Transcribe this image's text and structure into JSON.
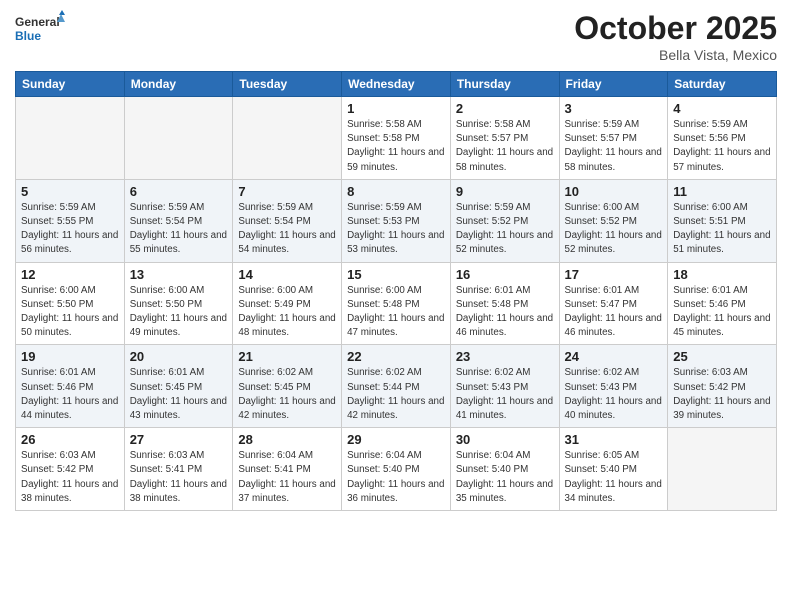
{
  "header": {
    "logo_general": "General",
    "logo_blue": "Blue",
    "month_title": "October 2025",
    "location": "Bella Vista, Mexico"
  },
  "days_of_week": [
    "Sunday",
    "Monday",
    "Tuesday",
    "Wednesday",
    "Thursday",
    "Friday",
    "Saturday"
  ],
  "weeks": [
    [
      {
        "day": "",
        "sunrise": "",
        "sunset": "",
        "daylight": "",
        "empty": true
      },
      {
        "day": "",
        "sunrise": "",
        "sunset": "",
        "daylight": "",
        "empty": true
      },
      {
        "day": "",
        "sunrise": "",
        "sunset": "",
        "daylight": "",
        "empty": true
      },
      {
        "day": "1",
        "sunrise": "Sunrise: 5:58 AM",
        "sunset": "Sunset: 5:58 PM",
        "daylight": "Daylight: 11 hours and 59 minutes."
      },
      {
        "day": "2",
        "sunrise": "Sunrise: 5:58 AM",
        "sunset": "Sunset: 5:57 PM",
        "daylight": "Daylight: 11 hours and 58 minutes."
      },
      {
        "day": "3",
        "sunrise": "Sunrise: 5:59 AM",
        "sunset": "Sunset: 5:57 PM",
        "daylight": "Daylight: 11 hours and 58 minutes."
      },
      {
        "day": "4",
        "sunrise": "Sunrise: 5:59 AM",
        "sunset": "Sunset: 5:56 PM",
        "daylight": "Daylight: 11 hours and 57 minutes."
      }
    ],
    [
      {
        "day": "5",
        "sunrise": "Sunrise: 5:59 AM",
        "sunset": "Sunset: 5:55 PM",
        "daylight": "Daylight: 11 hours and 56 minutes."
      },
      {
        "day": "6",
        "sunrise": "Sunrise: 5:59 AM",
        "sunset": "Sunset: 5:54 PM",
        "daylight": "Daylight: 11 hours and 55 minutes."
      },
      {
        "day": "7",
        "sunrise": "Sunrise: 5:59 AM",
        "sunset": "Sunset: 5:54 PM",
        "daylight": "Daylight: 11 hours and 54 minutes."
      },
      {
        "day": "8",
        "sunrise": "Sunrise: 5:59 AM",
        "sunset": "Sunset: 5:53 PM",
        "daylight": "Daylight: 11 hours and 53 minutes."
      },
      {
        "day": "9",
        "sunrise": "Sunrise: 5:59 AM",
        "sunset": "Sunset: 5:52 PM",
        "daylight": "Daylight: 11 hours and 52 minutes."
      },
      {
        "day": "10",
        "sunrise": "Sunrise: 6:00 AM",
        "sunset": "Sunset: 5:52 PM",
        "daylight": "Daylight: 11 hours and 52 minutes."
      },
      {
        "day": "11",
        "sunrise": "Sunrise: 6:00 AM",
        "sunset": "Sunset: 5:51 PM",
        "daylight": "Daylight: 11 hours and 51 minutes."
      }
    ],
    [
      {
        "day": "12",
        "sunrise": "Sunrise: 6:00 AM",
        "sunset": "Sunset: 5:50 PM",
        "daylight": "Daylight: 11 hours and 50 minutes."
      },
      {
        "day": "13",
        "sunrise": "Sunrise: 6:00 AM",
        "sunset": "Sunset: 5:50 PM",
        "daylight": "Daylight: 11 hours and 49 minutes."
      },
      {
        "day": "14",
        "sunrise": "Sunrise: 6:00 AM",
        "sunset": "Sunset: 5:49 PM",
        "daylight": "Daylight: 11 hours and 48 minutes."
      },
      {
        "day": "15",
        "sunrise": "Sunrise: 6:00 AM",
        "sunset": "Sunset: 5:48 PM",
        "daylight": "Daylight: 11 hours and 47 minutes."
      },
      {
        "day": "16",
        "sunrise": "Sunrise: 6:01 AM",
        "sunset": "Sunset: 5:48 PM",
        "daylight": "Daylight: 11 hours and 46 minutes."
      },
      {
        "day": "17",
        "sunrise": "Sunrise: 6:01 AM",
        "sunset": "Sunset: 5:47 PM",
        "daylight": "Daylight: 11 hours and 46 minutes."
      },
      {
        "day": "18",
        "sunrise": "Sunrise: 6:01 AM",
        "sunset": "Sunset: 5:46 PM",
        "daylight": "Daylight: 11 hours and 45 minutes."
      }
    ],
    [
      {
        "day": "19",
        "sunrise": "Sunrise: 6:01 AM",
        "sunset": "Sunset: 5:46 PM",
        "daylight": "Daylight: 11 hours and 44 minutes."
      },
      {
        "day": "20",
        "sunrise": "Sunrise: 6:01 AM",
        "sunset": "Sunset: 5:45 PM",
        "daylight": "Daylight: 11 hours and 43 minutes."
      },
      {
        "day": "21",
        "sunrise": "Sunrise: 6:02 AM",
        "sunset": "Sunset: 5:45 PM",
        "daylight": "Daylight: 11 hours and 42 minutes."
      },
      {
        "day": "22",
        "sunrise": "Sunrise: 6:02 AM",
        "sunset": "Sunset: 5:44 PM",
        "daylight": "Daylight: 11 hours and 42 minutes."
      },
      {
        "day": "23",
        "sunrise": "Sunrise: 6:02 AM",
        "sunset": "Sunset: 5:43 PM",
        "daylight": "Daylight: 11 hours and 41 minutes."
      },
      {
        "day": "24",
        "sunrise": "Sunrise: 6:02 AM",
        "sunset": "Sunset: 5:43 PM",
        "daylight": "Daylight: 11 hours and 40 minutes."
      },
      {
        "day": "25",
        "sunrise": "Sunrise: 6:03 AM",
        "sunset": "Sunset: 5:42 PM",
        "daylight": "Daylight: 11 hours and 39 minutes."
      }
    ],
    [
      {
        "day": "26",
        "sunrise": "Sunrise: 6:03 AM",
        "sunset": "Sunset: 5:42 PM",
        "daylight": "Daylight: 11 hours and 38 minutes."
      },
      {
        "day": "27",
        "sunrise": "Sunrise: 6:03 AM",
        "sunset": "Sunset: 5:41 PM",
        "daylight": "Daylight: 11 hours and 38 minutes."
      },
      {
        "day": "28",
        "sunrise": "Sunrise: 6:04 AM",
        "sunset": "Sunset: 5:41 PM",
        "daylight": "Daylight: 11 hours and 37 minutes."
      },
      {
        "day": "29",
        "sunrise": "Sunrise: 6:04 AM",
        "sunset": "Sunset: 5:40 PM",
        "daylight": "Daylight: 11 hours and 36 minutes."
      },
      {
        "day": "30",
        "sunrise": "Sunrise: 6:04 AM",
        "sunset": "Sunset: 5:40 PM",
        "daylight": "Daylight: 11 hours and 35 minutes."
      },
      {
        "day": "31",
        "sunrise": "Sunrise: 6:05 AM",
        "sunset": "Sunset: 5:40 PM",
        "daylight": "Daylight: 11 hours and 34 minutes."
      },
      {
        "day": "",
        "sunrise": "",
        "sunset": "",
        "daylight": "",
        "empty": true
      }
    ]
  ]
}
